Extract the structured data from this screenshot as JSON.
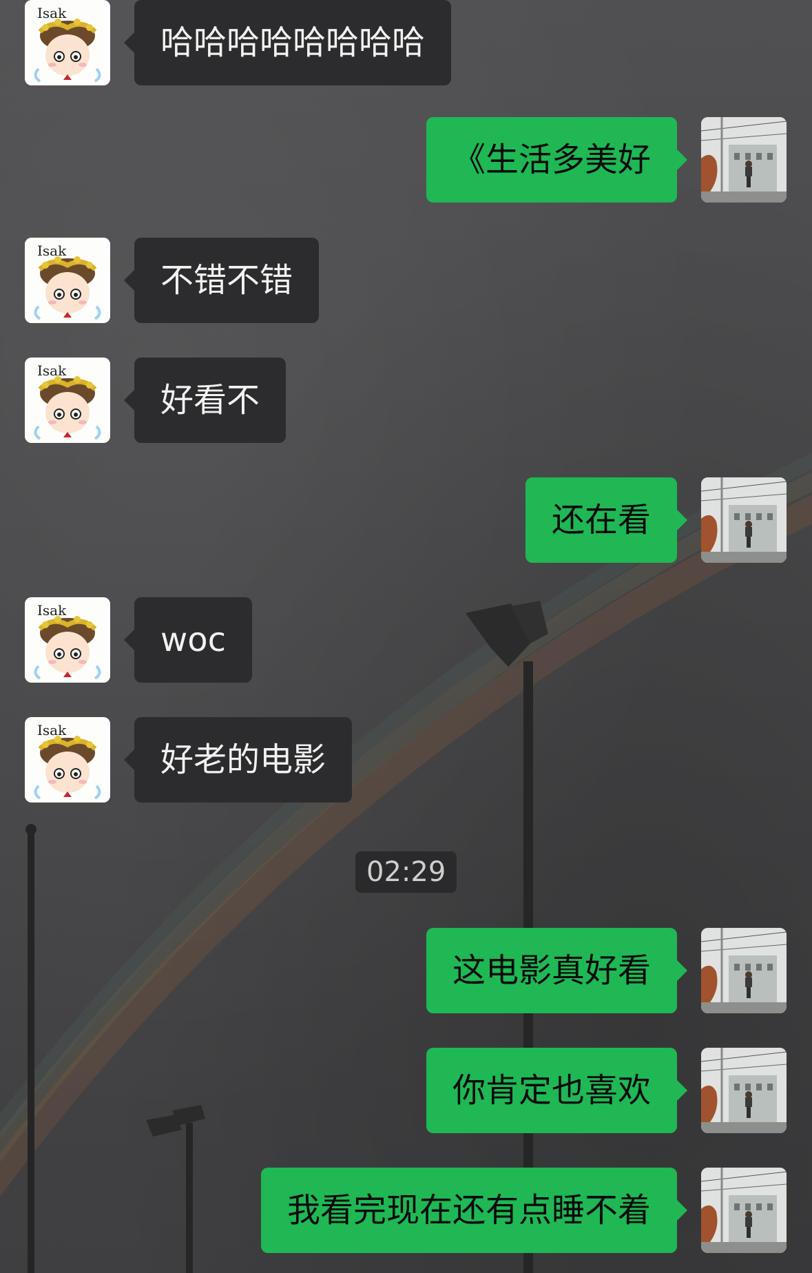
{
  "chat": {
    "timestamp": "02:29",
    "messages": [
      {
        "side": "in",
        "text": "哈哈哈哈哈哈哈哈"
      },
      {
        "side": "out",
        "text": "《生活多美好"
      },
      {
        "side": "in",
        "text": "不错不错"
      },
      {
        "side": "in",
        "text": "好看不"
      },
      {
        "side": "out",
        "text": "还在看"
      },
      {
        "side": "in",
        "text": "woc"
      },
      {
        "side": "in",
        "text": "好老的电影"
      },
      {
        "side": "out",
        "text": "这电影真好看"
      },
      {
        "side": "out",
        "text": "你肯定也喜欢"
      },
      {
        "side": "out",
        "text": "我看完现在还有点睡不着"
      }
    ]
  },
  "avatars": {
    "friend_label": "Isak"
  },
  "colors": {
    "incoming_bubble": "#2c2c2e",
    "outgoing_bubble": "#1fb854",
    "background": "#4a4a4c"
  }
}
